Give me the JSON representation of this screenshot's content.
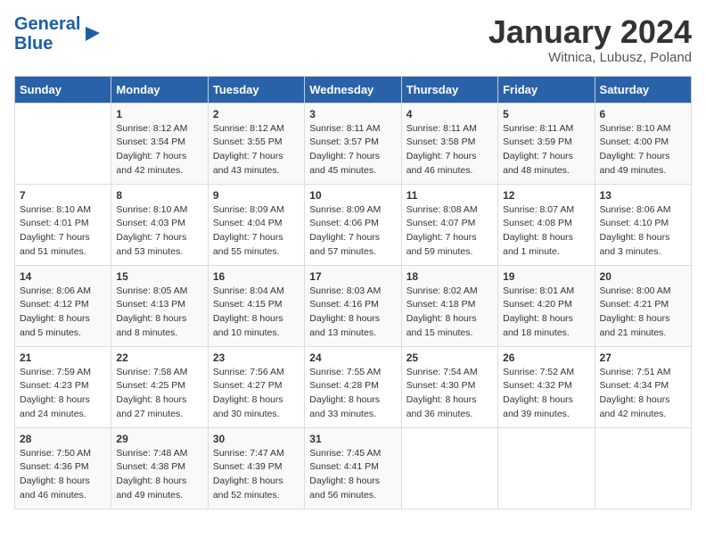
{
  "header": {
    "logo_general": "General",
    "logo_blue": "Blue",
    "month": "January 2024",
    "location": "Witnica, Lubusz, Poland"
  },
  "days_of_week": [
    "Sunday",
    "Monday",
    "Tuesday",
    "Wednesday",
    "Thursday",
    "Friday",
    "Saturday"
  ],
  "weeks": [
    [
      {
        "num": "",
        "sunrise": "",
        "sunset": "",
        "daylight": ""
      },
      {
        "num": "1",
        "sunrise": "Sunrise: 8:12 AM",
        "sunset": "Sunset: 3:54 PM",
        "daylight": "Daylight: 7 hours and 42 minutes."
      },
      {
        "num": "2",
        "sunrise": "Sunrise: 8:12 AM",
        "sunset": "Sunset: 3:55 PM",
        "daylight": "Daylight: 7 hours and 43 minutes."
      },
      {
        "num": "3",
        "sunrise": "Sunrise: 8:11 AM",
        "sunset": "Sunset: 3:57 PM",
        "daylight": "Daylight: 7 hours and 45 minutes."
      },
      {
        "num": "4",
        "sunrise": "Sunrise: 8:11 AM",
        "sunset": "Sunset: 3:58 PM",
        "daylight": "Daylight: 7 hours and 46 minutes."
      },
      {
        "num": "5",
        "sunrise": "Sunrise: 8:11 AM",
        "sunset": "Sunset: 3:59 PM",
        "daylight": "Daylight: 7 hours and 48 minutes."
      },
      {
        "num": "6",
        "sunrise": "Sunrise: 8:10 AM",
        "sunset": "Sunset: 4:00 PM",
        "daylight": "Daylight: 7 hours and 49 minutes."
      }
    ],
    [
      {
        "num": "7",
        "sunrise": "Sunrise: 8:10 AM",
        "sunset": "Sunset: 4:01 PM",
        "daylight": "Daylight: 7 hours and 51 minutes."
      },
      {
        "num": "8",
        "sunrise": "Sunrise: 8:10 AM",
        "sunset": "Sunset: 4:03 PM",
        "daylight": "Daylight: 7 hours and 53 minutes."
      },
      {
        "num": "9",
        "sunrise": "Sunrise: 8:09 AM",
        "sunset": "Sunset: 4:04 PM",
        "daylight": "Daylight: 7 hours and 55 minutes."
      },
      {
        "num": "10",
        "sunrise": "Sunrise: 8:09 AM",
        "sunset": "Sunset: 4:06 PM",
        "daylight": "Daylight: 7 hours and 57 minutes."
      },
      {
        "num": "11",
        "sunrise": "Sunrise: 8:08 AM",
        "sunset": "Sunset: 4:07 PM",
        "daylight": "Daylight: 7 hours and 59 minutes."
      },
      {
        "num": "12",
        "sunrise": "Sunrise: 8:07 AM",
        "sunset": "Sunset: 4:08 PM",
        "daylight": "Daylight: 8 hours and 1 minute."
      },
      {
        "num": "13",
        "sunrise": "Sunrise: 8:06 AM",
        "sunset": "Sunset: 4:10 PM",
        "daylight": "Daylight: 8 hours and 3 minutes."
      }
    ],
    [
      {
        "num": "14",
        "sunrise": "Sunrise: 8:06 AM",
        "sunset": "Sunset: 4:12 PM",
        "daylight": "Daylight: 8 hours and 5 minutes."
      },
      {
        "num": "15",
        "sunrise": "Sunrise: 8:05 AM",
        "sunset": "Sunset: 4:13 PM",
        "daylight": "Daylight: 8 hours and 8 minutes."
      },
      {
        "num": "16",
        "sunrise": "Sunrise: 8:04 AM",
        "sunset": "Sunset: 4:15 PM",
        "daylight": "Daylight: 8 hours and 10 minutes."
      },
      {
        "num": "17",
        "sunrise": "Sunrise: 8:03 AM",
        "sunset": "Sunset: 4:16 PM",
        "daylight": "Daylight: 8 hours and 13 minutes."
      },
      {
        "num": "18",
        "sunrise": "Sunrise: 8:02 AM",
        "sunset": "Sunset: 4:18 PM",
        "daylight": "Daylight: 8 hours and 15 minutes."
      },
      {
        "num": "19",
        "sunrise": "Sunrise: 8:01 AM",
        "sunset": "Sunset: 4:20 PM",
        "daylight": "Daylight: 8 hours and 18 minutes."
      },
      {
        "num": "20",
        "sunrise": "Sunrise: 8:00 AM",
        "sunset": "Sunset: 4:21 PM",
        "daylight": "Daylight: 8 hours and 21 minutes."
      }
    ],
    [
      {
        "num": "21",
        "sunrise": "Sunrise: 7:59 AM",
        "sunset": "Sunset: 4:23 PM",
        "daylight": "Daylight: 8 hours and 24 minutes."
      },
      {
        "num": "22",
        "sunrise": "Sunrise: 7:58 AM",
        "sunset": "Sunset: 4:25 PM",
        "daylight": "Daylight: 8 hours and 27 minutes."
      },
      {
        "num": "23",
        "sunrise": "Sunrise: 7:56 AM",
        "sunset": "Sunset: 4:27 PM",
        "daylight": "Daylight: 8 hours and 30 minutes."
      },
      {
        "num": "24",
        "sunrise": "Sunrise: 7:55 AM",
        "sunset": "Sunset: 4:28 PM",
        "daylight": "Daylight: 8 hours and 33 minutes."
      },
      {
        "num": "25",
        "sunrise": "Sunrise: 7:54 AM",
        "sunset": "Sunset: 4:30 PM",
        "daylight": "Daylight: 8 hours and 36 minutes."
      },
      {
        "num": "26",
        "sunrise": "Sunrise: 7:52 AM",
        "sunset": "Sunset: 4:32 PM",
        "daylight": "Daylight: 8 hours and 39 minutes."
      },
      {
        "num": "27",
        "sunrise": "Sunrise: 7:51 AM",
        "sunset": "Sunset: 4:34 PM",
        "daylight": "Daylight: 8 hours and 42 minutes."
      }
    ],
    [
      {
        "num": "28",
        "sunrise": "Sunrise: 7:50 AM",
        "sunset": "Sunset: 4:36 PM",
        "daylight": "Daylight: 8 hours and 46 minutes."
      },
      {
        "num": "29",
        "sunrise": "Sunrise: 7:48 AM",
        "sunset": "Sunset: 4:38 PM",
        "daylight": "Daylight: 8 hours and 49 minutes."
      },
      {
        "num": "30",
        "sunrise": "Sunrise: 7:47 AM",
        "sunset": "Sunset: 4:39 PM",
        "daylight": "Daylight: 8 hours and 52 minutes."
      },
      {
        "num": "31",
        "sunrise": "Sunrise: 7:45 AM",
        "sunset": "Sunset: 4:41 PM",
        "daylight": "Daylight: 8 hours and 56 minutes."
      },
      {
        "num": "",
        "sunrise": "",
        "sunset": "",
        "daylight": ""
      },
      {
        "num": "",
        "sunrise": "",
        "sunset": "",
        "daylight": ""
      },
      {
        "num": "",
        "sunrise": "",
        "sunset": "",
        "daylight": ""
      }
    ]
  ]
}
